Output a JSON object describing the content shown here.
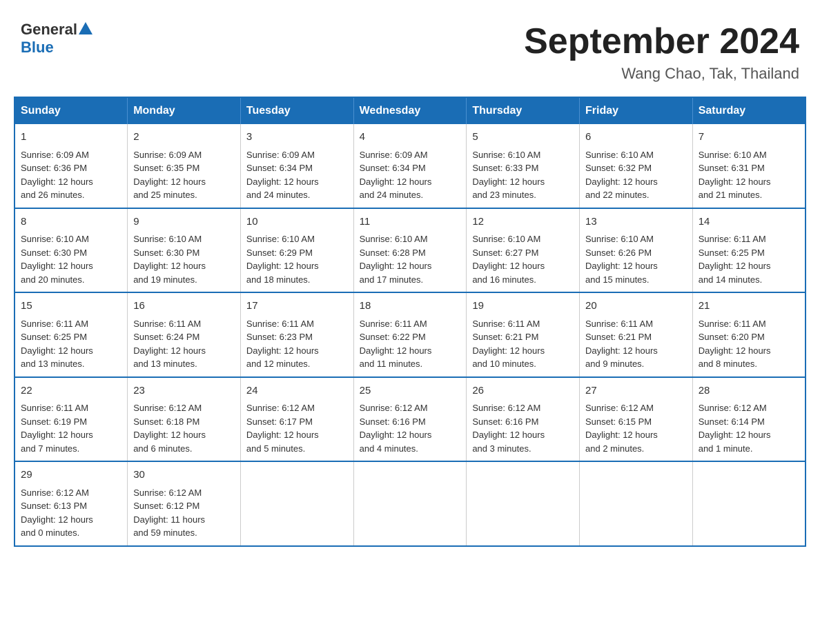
{
  "logo": {
    "general": "General",
    "blue": "Blue"
  },
  "title": "September 2024",
  "location": "Wang Chao, Tak, Thailand",
  "weekdays": [
    "Sunday",
    "Monday",
    "Tuesday",
    "Wednesday",
    "Thursday",
    "Friday",
    "Saturday"
  ],
  "weeks": [
    [
      {
        "day": "1",
        "sunrise": "6:09 AM",
        "sunset": "6:36 PM",
        "daylight": "12 hours and 26 minutes."
      },
      {
        "day": "2",
        "sunrise": "6:09 AM",
        "sunset": "6:35 PM",
        "daylight": "12 hours and 25 minutes."
      },
      {
        "day": "3",
        "sunrise": "6:09 AM",
        "sunset": "6:34 PM",
        "daylight": "12 hours and 24 minutes."
      },
      {
        "day": "4",
        "sunrise": "6:09 AM",
        "sunset": "6:34 PM",
        "daylight": "12 hours and 24 minutes."
      },
      {
        "day": "5",
        "sunrise": "6:10 AM",
        "sunset": "6:33 PM",
        "daylight": "12 hours and 23 minutes."
      },
      {
        "day": "6",
        "sunrise": "6:10 AM",
        "sunset": "6:32 PM",
        "daylight": "12 hours and 22 minutes."
      },
      {
        "day": "7",
        "sunrise": "6:10 AM",
        "sunset": "6:31 PM",
        "daylight": "12 hours and 21 minutes."
      }
    ],
    [
      {
        "day": "8",
        "sunrise": "6:10 AM",
        "sunset": "6:30 PM",
        "daylight": "12 hours and 20 minutes."
      },
      {
        "day": "9",
        "sunrise": "6:10 AM",
        "sunset": "6:30 PM",
        "daylight": "12 hours and 19 minutes."
      },
      {
        "day": "10",
        "sunrise": "6:10 AM",
        "sunset": "6:29 PM",
        "daylight": "12 hours and 18 minutes."
      },
      {
        "day": "11",
        "sunrise": "6:10 AM",
        "sunset": "6:28 PM",
        "daylight": "12 hours and 17 minutes."
      },
      {
        "day": "12",
        "sunrise": "6:10 AM",
        "sunset": "6:27 PM",
        "daylight": "12 hours and 16 minutes."
      },
      {
        "day": "13",
        "sunrise": "6:10 AM",
        "sunset": "6:26 PM",
        "daylight": "12 hours and 15 minutes."
      },
      {
        "day": "14",
        "sunrise": "6:11 AM",
        "sunset": "6:25 PM",
        "daylight": "12 hours and 14 minutes."
      }
    ],
    [
      {
        "day": "15",
        "sunrise": "6:11 AM",
        "sunset": "6:25 PM",
        "daylight": "12 hours and 13 minutes."
      },
      {
        "day": "16",
        "sunrise": "6:11 AM",
        "sunset": "6:24 PM",
        "daylight": "12 hours and 13 minutes."
      },
      {
        "day": "17",
        "sunrise": "6:11 AM",
        "sunset": "6:23 PM",
        "daylight": "12 hours and 12 minutes."
      },
      {
        "day": "18",
        "sunrise": "6:11 AM",
        "sunset": "6:22 PM",
        "daylight": "12 hours and 11 minutes."
      },
      {
        "day": "19",
        "sunrise": "6:11 AM",
        "sunset": "6:21 PM",
        "daylight": "12 hours and 10 minutes."
      },
      {
        "day": "20",
        "sunrise": "6:11 AM",
        "sunset": "6:21 PM",
        "daylight": "12 hours and 9 minutes."
      },
      {
        "day": "21",
        "sunrise": "6:11 AM",
        "sunset": "6:20 PM",
        "daylight": "12 hours and 8 minutes."
      }
    ],
    [
      {
        "day": "22",
        "sunrise": "6:11 AM",
        "sunset": "6:19 PM",
        "daylight": "12 hours and 7 minutes."
      },
      {
        "day": "23",
        "sunrise": "6:12 AM",
        "sunset": "6:18 PM",
        "daylight": "12 hours and 6 minutes."
      },
      {
        "day": "24",
        "sunrise": "6:12 AM",
        "sunset": "6:17 PM",
        "daylight": "12 hours and 5 minutes."
      },
      {
        "day": "25",
        "sunrise": "6:12 AM",
        "sunset": "6:16 PM",
        "daylight": "12 hours and 4 minutes."
      },
      {
        "day": "26",
        "sunrise": "6:12 AM",
        "sunset": "6:16 PM",
        "daylight": "12 hours and 3 minutes."
      },
      {
        "day": "27",
        "sunrise": "6:12 AM",
        "sunset": "6:15 PM",
        "daylight": "12 hours and 2 minutes."
      },
      {
        "day": "28",
        "sunrise": "6:12 AM",
        "sunset": "6:14 PM",
        "daylight": "12 hours and 1 minute."
      }
    ],
    [
      {
        "day": "29",
        "sunrise": "6:12 AM",
        "sunset": "6:13 PM",
        "daylight": "12 hours and 0 minutes."
      },
      {
        "day": "30",
        "sunrise": "6:12 AM",
        "sunset": "6:12 PM",
        "daylight": "11 hours and 59 minutes."
      },
      null,
      null,
      null,
      null,
      null
    ]
  ],
  "labels": {
    "sunrise": "Sunrise:",
    "sunset": "Sunset:",
    "daylight": "Daylight:"
  }
}
